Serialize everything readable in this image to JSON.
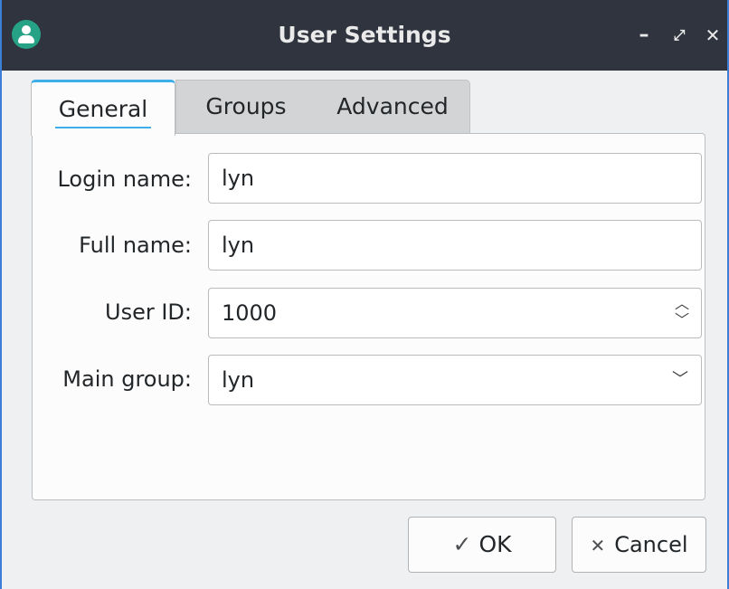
{
  "window": {
    "title": "User Settings",
    "icon": "user-icon",
    "controls": {
      "minimize": "–",
      "maximize": "⤢",
      "close": "✕"
    }
  },
  "tabs": [
    {
      "label": "General",
      "active": true
    },
    {
      "label": "Groups",
      "active": false
    },
    {
      "label": "Advanced",
      "active": false
    }
  ],
  "form": {
    "login_name": {
      "label": "Login name:",
      "value": "lyn"
    },
    "full_name": {
      "label": "Full name:",
      "value": "lyn"
    },
    "user_id": {
      "label": "User ID:",
      "value": "1000"
    },
    "main_group": {
      "label": "Main group:",
      "value": "lyn"
    }
  },
  "buttons": {
    "ok": "OK",
    "cancel": "Cancel"
  },
  "colors": {
    "titlebar": "#2f343f",
    "accent": "#3daee9",
    "app_icon": "#26a386",
    "window_border": "#3d7fd6"
  }
}
